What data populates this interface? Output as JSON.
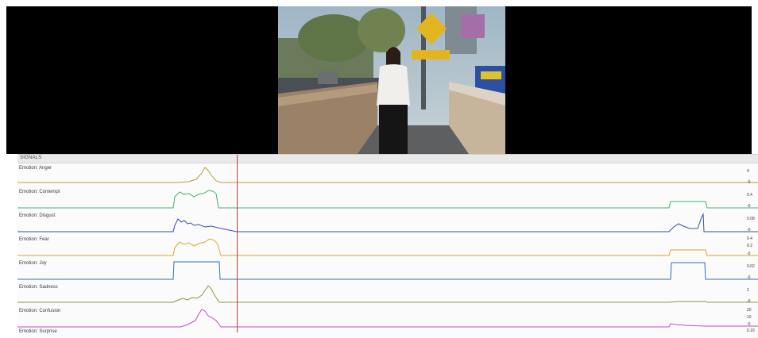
{
  "panel_title": "SIGNALS",
  "playhead_color": "#c0392b",
  "signals": [
    {
      "label": "Emotion: Anger",
      "color": "#b5a23a",
      "scale": [
        "4",
        "-0"
      ]
    },
    {
      "label": "Emotion: Contempt",
      "color": "#3cb371",
      "scale": [
        "0.4",
        "-0"
      ]
    },
    {
      "label": "Emotion: Disgust",
      "color": "#3a47b8",
      "scale": [
        "0.08",
        "-0"
      ]
    },
    {
      "label": "Emotion: Fear",
      "color": "#d4a82a",
      "scale": [
        "0.4",
        "0.2",
        "-0"
      ]
    },
    {
      "label": "Emotion: Joy",
      "color": "#2f6fb0",
      "scale": [
        "0.02",
        "-0"
      ]
    },
    {
      "label": "Emotion: Sadness",
      "color": "#8a9a3a",
      "scale": [
        "2",
        "-0"
      ]
    },
    {
      "label": "Emotion: Confusion",
      "color": "#c04fc0",
      "scale": [
        "20",
        "10",
        "-0"
      ]
    },
    {
      "label": "Emotion: Surprise",
      "color": "#d08a8a",
      "scale": [
        "0.16"
      ]
    }
  ]
}
